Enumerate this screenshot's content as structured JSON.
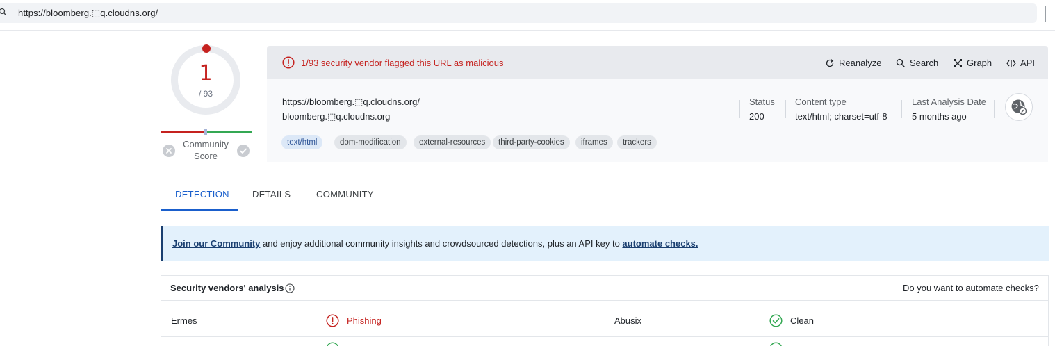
{
  "search": {
    "value": "https://bloomberg.⬚q.cloudns.org/"
  },
  "score": {
    "detected": "1",
    "total": "/ 93",
    "community_label": "Community Score"
  },
  "alert": {
    "text": "1/93 security vendor flagged this URL as malicious"
  },
  "actions": [
    {
      "label": "Reanalyze",
      "icon": "refresh-icon"
    },
    {
      "label": "Search",
      "icon": "search-icon"
    },
    {
      "label": "Graph",
      "icon": "graph-icon"
    },
    {
      "label": "API",
      "icon": "api-icon"
    }
  ],
  "summary": {
    "url": "https://bloomberg.⬚q.cloudns.org/",
    "host": "bloomberg.⬚q.cloudns.org",
    "status_label": "Status",
    "status_value": "200",
    "content_type_label": "Content type",
    "content_type_value": "text/html; charset=utf-8",
    "last_analysis_label": "Last Analysis Date",
    "last_analysis_value": "5 months ago"
  },
  "tags": [
    "text/html",
    "dom-modification",
    "external-resources",
    "third-party-cookies",
    "iframes",
    "trackers"
  ],
  "tabs": [
    {
      "label": "DETECTION",
      "active": true
    },
    {
      "label": "DETAILS",
      "active": false
    },
    {
      "label": "COMMUNITY",
      "active": false
    }
  ],
  "banner": {
    "link1": "Join our Community",
    "middle": " and enjoy additional community insights and crowdsourced detections, plus an API key to ",
    "link2": "automate checks."
  },
  "vendors": {
    "title": "Security vendors' analysis",
    "automate_prompt": "Do you want to automate checks?",
    "rows": [
      {
        "left_name": "Ermes",
        "left_result": "Phishing",
        "right_name": "Abusix",
        "right_result": "Clean"
      }
    ]
  },
  "colors": {
    "malicious": "#c5221f",
    "clean": "#34a853",
    "accent": "#1a5fcc",
    "banner_bg": "#e3f1fc"
  }
}
